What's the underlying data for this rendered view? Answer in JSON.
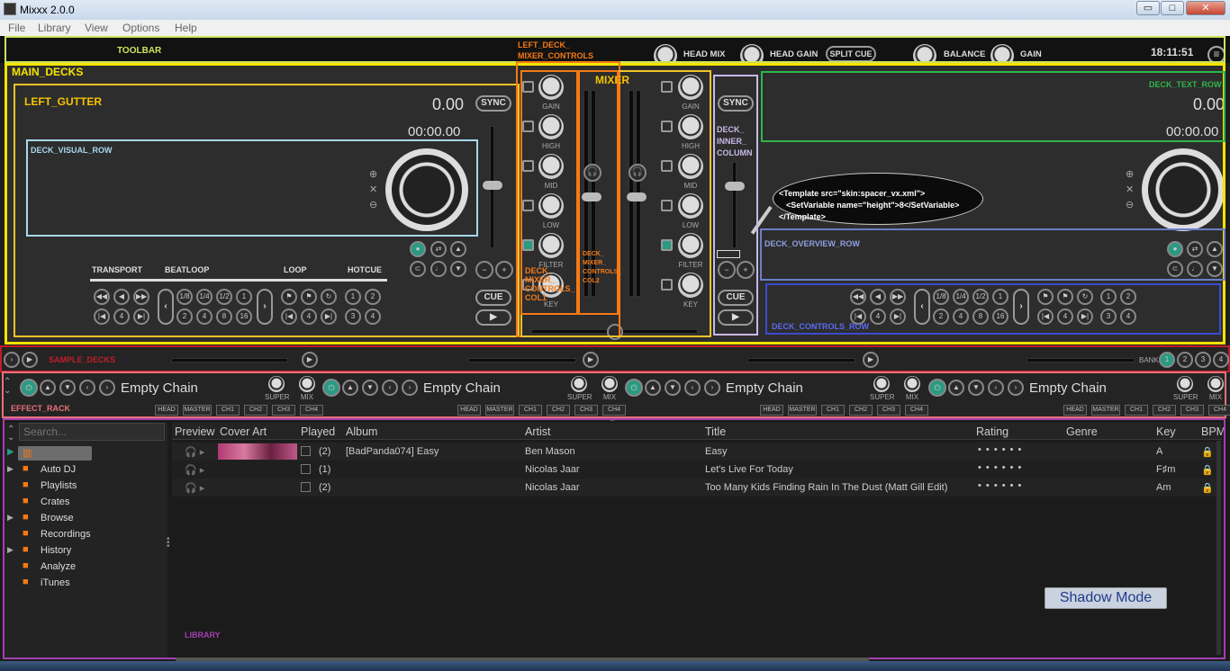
{
  "window": {
    "title": "Mixxx 2.0.0",
    "min": "▭",
    "max": "□",
    "close": "✕"
  },
  "menu": [
    "File",
    "Library",
    "View",
    "Options",
    "Help"
  ],
  "toolbar": {
    "headmix": "HEAD MIX",
    "headgain": "HEAD GAIN",
    "splitcue": "SPLIT CUE",
    "balance": "BALANCE",
    "gain": "GAIN",
    "clock": "18:11:51"
  },
  "overlays": {
    "toolbar": "TOOLBAR",
    "main_decks": "MAIN_DECKS",
    "left_gutter": "LEFT_GUTTER",
    "deck_visual_row": "DECK_VISUAL_ROW",
    "left_deck_mixer_controls": "LEFT_DECK_\nMIXER_CONTROLS",
    "mixer": "MIXER",
    "deck_inner_column": "DECK_\nINNER_\nCOLUMN",
    "deck_text_row": "DECK_TEXT_ROW",
    "deck_overview_row": "DECK_OVERVIEW_ROW",
    "deck_controls_row": "DECK_CONTROLS_ROW",
    "deck_mixer_controls_col1": "DECK_\nMIXER_\nCONTROLS_\nCOL1",
    "deck_mixer_controls_col2": "DECK_\nMIXER_\nCONTROLS_\nCOL2",
    "sample_decks": "SAMPLE_DECKS",
    "effect_rack": "EFFECT_RACK",
    "library": "LIBRARY"
  },
  "left_deck": {
    "rate": "0.00",
    "time": "00:00.00",
    "sync": "SYNC",
    "cue": "CUE"
  },
  "right_deck": {
    "rate": "0.00",
    "time": "00:00.00",
    "sync": "SYNC",
    "cue": "CUE"
  },
  "deck_groups": {
    "transport": "TRANSPORT",
    "beatloop": "BEATLOOP",
    "loop": "LOOP",
    "hotcue": "HOTCUE"
  },
  "beatloop": [
    "1/8",
    "1/4",
    "1/2",
    "1",
    "2",
    "4",
    "8",
    "16"
  ],
  "hotcues": [
    "1",
    "2",
    "3",
    "4"
  ],
  "mixer_knobs": [
    "GAIN",
    "HIGH",
    "MID",
    "LOW",
    "FILTER",
    "KEY"
  ],
  "note": [
    "<Template src=\"skin:spacer_vx.xml\">",
    "  <SetVariable name=\"height\">8</SetVariable>",
    "</Template>"
  ],
  "bank": {
    "label": "BANK",
    "items": [
      "1",
      "2",
      "3",
      "4"
    ]
  },
  "fx_units": [
    {
      "name": "Empty Chain",
      "super": "SUPER",
      "mix": "MIX",
      "buttons": [
        "HEAD",
        "MASTER",
        "CH1",
        "CH2",
        "CH3",
        "CH4"
      ]
    },
    {
      "name": "Empty Chain",
      "super": "SUPER",
      "mix": "MIX",
      "buttons": [
        "HEAD",
        "MASTER",
        "CH1",
        "CH2",
        "CH3",
        "CH4"
      ]
    },
    {
      "name": "Empty Chain",
      "super": "SUPER",
      "mix": "MIX",
      "buttons": [
        "HEAD",
        "MASTER",
        "CH1",
        "CH2",
        "CH3",
        "CH4"
      ]
    },
    {
      "name": "Empty Chain",
      "super": "SUPER",
      "mix": "MIX",
      "buttons": [
        "HEAD",
        "MASTER",
        "CH1",
        "CH2",
        "CH3",
        "CH4"
      ]
    }
  ],
  "library": {
    "search_placeholder": "Search...",
    "tree": [
      {
        "label": "Auto DJ",
        "icon": "autodj-icon"
      },
      {
        "label": "Playlists",
        "icon": "playlist-icon"
      },
      {
        "label": "Crates",
        "icon": "crate-icon"
      },
      {
        "label": "Browse",
        "icon": "search-icon"
      },
      {
        "label": "Recordings",
        "icon": "recording-icon"
      },
      {
        "label": "History",
        "icon": "history-icon"
      },
      {
        "label": "Analyze",
        "icon": "analyze-icon"
      },
      {
        "label": "iTunes",
        "icon": "itunes-icon"
      }
    ],
    "columns": [
      "Preview",
      "Cover Art",
      "Played",
      "Album",
      "Artist",
      "Title",
      "Rating",
      "Genre",
      "Key",
      "BPM"
    ],
    "rows": [
      {
        "played": "(2)",
        "album": "[BadPanda074] Easy",
        "artist": "Ben Mason",
        "title": "Easy",
        "rating": "• • • • • •",
        "key": "A"
      },
      {
        "played": "(1)",
        "album": "",
        "artist": "Nicolas Jaar",
        "title": "Let's Live For Today",
        "rating": "• • • • • •",
        "key": "F♯m"
      },
      {
        "played": "(2)",
        "album": "",
        "artist": "Nicolas Jaar",
        "title": "Too Many Kids Finding Rain In The Dust (Matt Gill Edit)",
        "rating": "• • • • • •",
        "key": "Am"
      }
    ]
  },
  "shadow_mode": "Shadow Mode",
  "colors": {
    "yellow": "#f5e400",
    "orange": "#f47a16",
    "lightblue": "#a8d7ee",
    "green": "#2fb54a",
    "blue": "#3b4bd1",
    "periwinkle": "#6a7fc8",
    "lavender": "#c7b9e6",
    "pink": "#e8707a",
    "purple": "#a23fb0",
    "lime": "#cbe45a",
    "red": "#c01d2a",
    "teal": "#2a9a82"
  }
}
